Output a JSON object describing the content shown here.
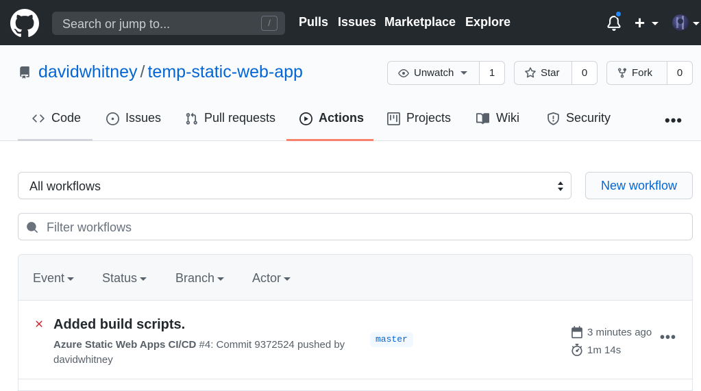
{
  "header": {
    "search_placeholder": "Search or jump to...",
    "search_shortcut": "/",
    "nav": [
      "Pulls",
      "Issues",
      "Marketplace",
      "Explore"
    ],
    "plus": "+"
  },
  "repo": {
    "owner": "davidwhitney",
    "separator": "/",
    "name": "temp-static-web-app",
    "watch_label": "Unwatch",
    "watch_count": "1",
    "star_label": "Star",
    "star_count": "0",
    "fork_label": "Fork",
    "fork_count": "0"
  },
  "tabs": [
    {
      "label": "Code",
      "icon": "code-icon"
    },
    {
      "label": "Issues",
      "icon": "issue-icon"
    },
    {
      "label": "Pull requests",
      "icon": "pull-request-icon"
    },
    {
      "label": "Actions",
      "icon": "play-icon",
      "selected": true
    },
    {
      "label": "Projects",
      "icon": "project-icon"
    },
    {
      "label": "Wiki",
      "icon": "book-icon"
    },
    {
      "label": "Security",
      "icon": "shield-icon"
    }
  ],
  "more": "•••",
  "workflows": {
    "select_value": "All workflows",
    "new_workflow": "New workflow",
    "filter_placeholder": "Filter workflows",
    "filters": [
      "Event",
      "Status",
      "Branch",
      "Actor"
    ]
  },
  "runs": [
    {
      "status": "failure",
      "title": "Added build scripts.",
      "workflow": "Azure Static Web Apps CI/CD",
      "detail": "#4: Commit 9372524 pushed by",
      "author": "davidwhitney",
      "branch": "master",
      "time_ago": "3 minutes ago",
      "duration": "1m 14s",
      "menu": "•••"
    }
  ],
  "colors": {
    "header_bg": "#24292e",
    "link": "#0366d6",
    "selected_tab": "#f9826c",
    "failure": "#cb2431",
    "notification": "#2188ff"
  }
}
